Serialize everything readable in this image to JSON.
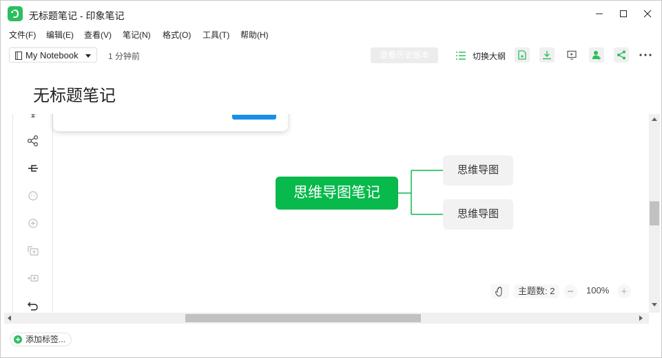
{
  "window": {
    "title": "无标题笔记 - 印象笔记",
    "minimize_icon": "minimize-icon",
    "maximize_icon": "maximize-icon",
    "close_icon": "close-icon"
  },
  "menu": {
    "items": [
      "文件(F)",
      "编辑(E)",
      "查看(V)",
      "笔记(N)",
      "格式(O)",
      "工具(T)",
      "帮助(H)"
    ]
  },
  "toolbar": {
    "notebook_label": "My Notebook",
    "last_edited": "1 分钟前",
    "history_label": "查看历史版本",
    "outline_label": "切换大纲",
    "icons": [
      "share-note-icon",
      "download-icon",
      "present-icon",
      "add-collaborator-icon",
      "share-icon",
      "more-icon"
    ],
    "accent_color": "#2dbe60"
  },
  "note": {
    "title": "无标题笔记"
  },
  "mindmap": {
    "root": "思维导图笔记",
    "children": [
      "思维导图",
      "思维导图"
    ],
    "root_color": "#08b94c",
    "left_tools": [
      "style-icon",
      "structure-icon",
      "subtopic-icon",
      "emoji-icon",
      "add-icon",
      "insert-image-icon",
      "insert-video-icon",
      "undo-icon"
    ],
    "topic_count": "主题数: 2",
    "zoom": "100%"
  },
  "tags": {
    "add_label": "添加标签..."
  }
}
